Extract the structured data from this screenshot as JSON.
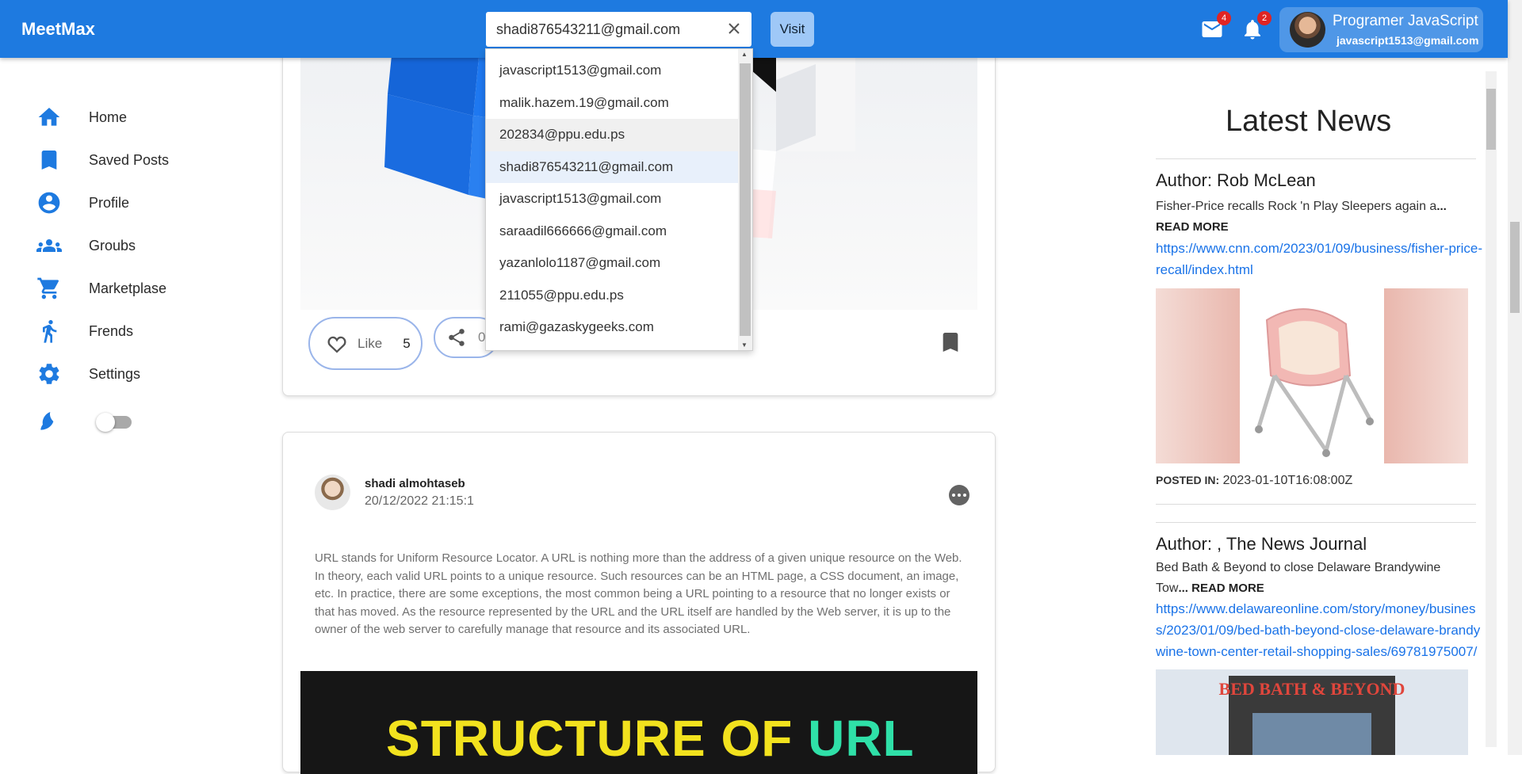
{
  "header": {
    "brand": "MeetMax",
    "search_value": "shadi876543211@gmail.com",
    "visit_label": "Visit",
    "messages_badge": "4",
    "notifications_badge": "2",
    "user_name": "Programer JavaScript",
    "user_email": "javascript1513@gmail.com"
  },
  "dropdown": {
    "items": [
      "javascript1513@gmail.com",
      "malik.hazem.19@gmail.com",
      "202834@ppu.edu.ps",
      "shadi876543211@gmail.com",
      "javascript1513@gmail.com",
      "saraadil666666@gmail.com",
      "yazanlolo1187@gmail.com",
      "211055@ppu.edu.ps",
      "rami@gazaskygeeks.com"
    ],
    "hovered_index": 2,
    "selected_index": 3
  },
  "sidebar": {
    "items": [
      {
        "label": "Home",
        "icon": "home-icon"
      },
      {
        "label": "Saved Posts",
        "icon": "bookmark-icon"
      },
      {
        "label": "Profile",
        "icon": "account-circle-icon"
      },
      {
        "label": "Groubs",
        "icon": "groups-icon"
      },
      {
        "label": "Marketplase",
        "icon": "cart-icon"
      },
      {
        "label": "Frends",
        "icon": "person-walking-icon"
      },
      {
        "label": "Settings",
        "icon": "gear-icon"
      }
    ],
    "dark_mode_enabled": false
  },
  "post1": {
    "like_label": "Like",
    "like_count": "5",
    "share_count": "0"
  },
  "post2": {
    "author": "shadi almohtaseb",
    "date": "20/12/2022 21:15:1",
    "text": "URL stands for Uniform Resource Locator. A URL is nothing more than the address of a given unique resource on the Web. In theory, each valid URL points to a unique resource. Such resources can be an HTML page, a CSS document, an image, etc. In practice, there are some exceptions, the most common being a URL pointing to a resource that no longer exists or that has moved. As the resource represented by the URL and the URL itself are handled by the Web server, it is up to the owner of the web server to carefully manage that resource and its associated URL.",
    "image_title_part1": "STRUCTURE OF ",
    "image_title_part2": "URL"
  },
  "news": {
    "heading": "Latest News",
    "articles": [
      {
        "author": "Author: Rob McLean",
        "description": "Fisher-Price recalls Rock 'n Play Sleepers again a",
        "read_more": "... READ MORE",
        "url": "https://www.cnn.com/2023/01/09/business/fisher-price-recall/index.html",
        "posted_label": "POSTED IN:",
        "posted_value": "2023-01-10T16:08:00Z"
      },
      {
        "author": "Author: , The News Journal",
        "description": "Bed Bath & Beyond to close Delaware Brandywine Tow",
        "read_more": "... READ MORE",
        "url": "https://www.delawareonline.com/story/money/business/2023/01/09/bed-bath-beyond-close-delaware-brandywine-town-center-retail-shopping-sales/69781975007/",
        "image_sign": "BED BATH & BEYOND"
      }
    ]
  },
  "colors": {
    "primary": "#1e7ae0",
    "badge": "#e02424",
    "link": "#1a73e8"
  }
}
